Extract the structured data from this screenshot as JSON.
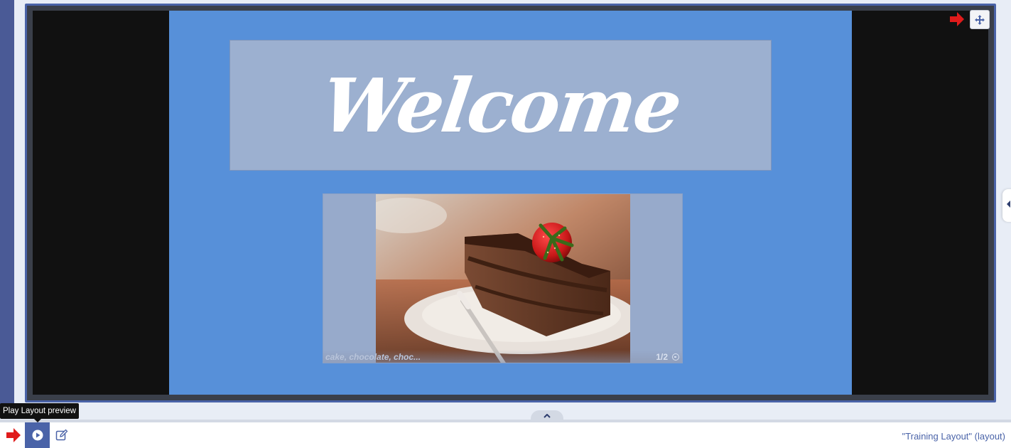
{
  "preview": {
    "welcome_text": "Welcome",
    "image_tags": "cake, chocolate, choc...",
    "image_counter": "1/2",
    "image_subject": "chocolate cake slice with strawberry on plate"
  },
  "toolbar": {
    "tooltip": "Play Layout preview",
    "layout_name": "\"Training Layout\" (layout)"
  },
  "icons": {
    "move": "move-arrows-icon",
    "play": "play-circle-icon",
    "edit": "edit-icon",
    "collapse": "chevron-up-icon",
    "side_panel": "chevron-left-icon",
    "zoom": "zoom-icon",
    "annotation": "red-arrow-icon"
  },
  "colors": {
    "canvas_background": "#5790d9",
    "accent": "#4a63a8",
    "annotation": "#e01b1b"
  }
}
